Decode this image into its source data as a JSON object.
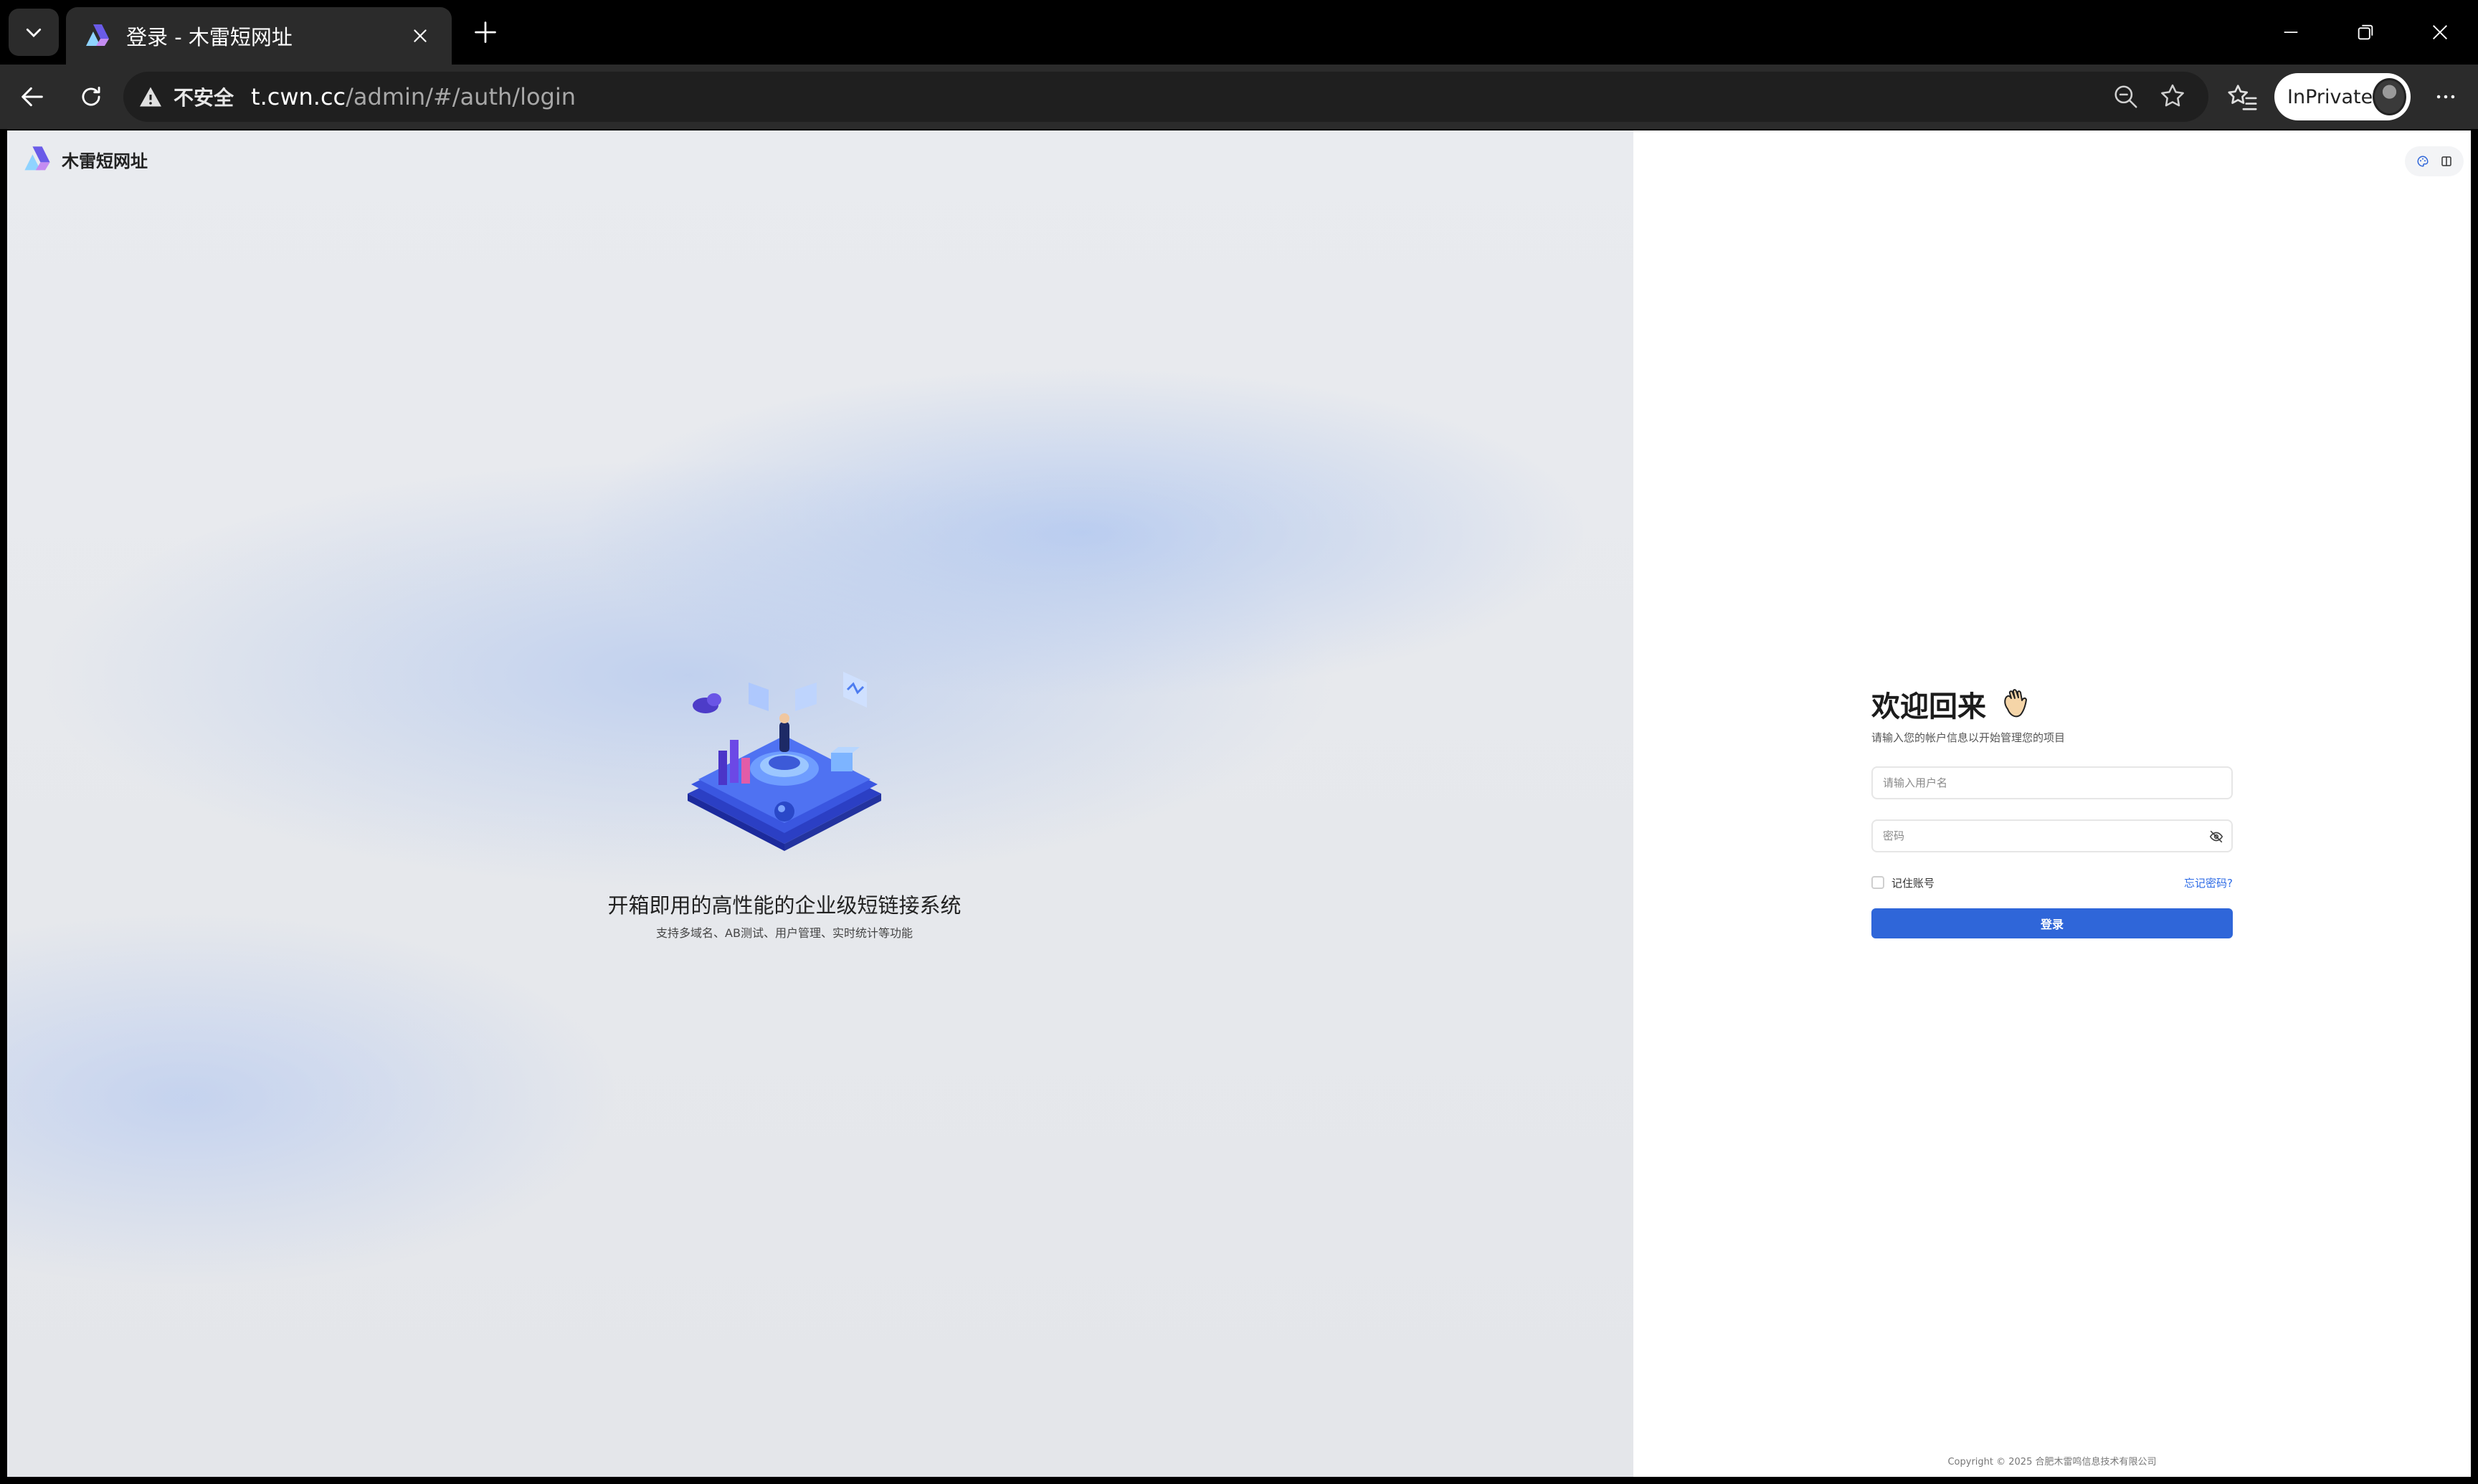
{
  "browser": {
    "tab_title": "登录 - 木雷短网址",
    "security_label": "不安全",
    "url_host": "t.cwn.cc",
    "url_path": "/admin/#/auth/login",
    "profile_label": "InPrivate"
  },
  "brand": {
    "name": "木雷短网址"
  },
  "hero": {
    "title": "开箱即用的高性能的企业级短链接系统",
    "subtitle": "支持多域名、AB测试、用户管理、实时统计等功能"
  },
  "login": {
    "title": "欢迎回来",
    "description": "请输入您的帐户信息以开始管理您的项目",
    "username_placeholder": "请输入用户名",
    "username_value": "",
    "password_placeholder": "密码",
    "password_value": "",
    "remember_label": "记住账号",
    "remember_checked": false,
    "forgot_label": "忘记密码?",
    "submit_label": "登录"
  },
  "footer": {
    "copyright": "Copyright © 2025 合肥木雷鸣信息技术有限公司"
  },
  "colors": {
    "primary": "#2f66d9",
    "link": "#2d6be6",
    "browser_bg": "#2b2b2b"
  },
  "icons": [
    "chevron-down-icon",
    "favicon-logo",
    "close-icon",
    "plus-icon",
    "minimize-icon",
    "restore-icon",
    "back-arrow-icon",
    "reload-icon",
    "warning-icon",
    "zoom-out-icon",
    "star-icon",
    "favorites-icon",
    "more-icon",
    "color-palette-icon",
    "layout-icon",
    "waving-hand-icon",
    "eye-off-icon"
  ]
}
